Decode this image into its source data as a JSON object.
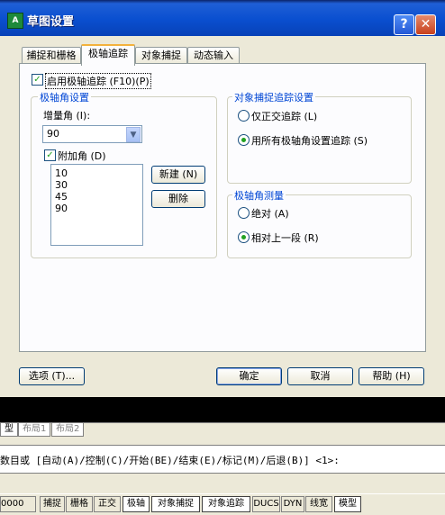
{
  "window": {
    "title": "草图设置",
    "app_icon": "autocad-app-icon",
    "help_glyph": "?",
    "close_glyph": "✕"
  },
  "tabs": [
    {
      "label": "捕捉和栅格",
      "active": false
    },
    {
      "label": "极轴追踪",
      "active": true
    },
    {
      "label": "对象捕捉",
      "active": false
    },
    {
      "label": "动态输入",
      "active": false
    }
  ],
  "polar": {
    "enable_label": "启用极轴追踪 (F10)(P)",
    "enable_checked": true,
    "group_title": "极轴角设置",
    "increment_label": "增量角 (I):",
    "increment_value": "90",
    "additional_label": "附加角 (D)",
    "additional_checked": true,
    "additional_angles": [
      "10",
      "30",
      "45",
      "90"
    ],
    "new_button": "新建 (N)",
    "delete_button": "删除"
  },
  "snap_tracking": {
    "group_title": "对象捕捉追踪设置",
    "orthogonal_label": "仅正交追踪 (L)",
    "orthogonal_selected": false,
    "all_polar_label": "用所有极轴角设置追踪 (S)",
    "all_polar_selected": true
  },
  "polar_measure": {
    "group_title": "极轴角测量",
    "absolute_label": "绝对 (A)",
    "absolute_selected": false,
    "relative_label": "相对上一段 (R)",
    "relative_selected": true
  },
  "footer": {
    "options_button": "选项 (T)...",
    "ok_button": "确定",
    "cancel_button": "取消",
    "help_button": "帮助 (H)"
  },
  "layout_tabs": [
    "型",
    "布局1",
    "布局2"
  ],
  "command_line": "数目或 [自动(A)/控制(C)/开始(BE)/结束(E)/标记(M)/后退(B)] <1>:",
  "status_bar": {
    "coordinates": "0000",
    "buttons": [
      {
        "label": "捕捉",
        "on": false
      },
      {
        "label": "栅格",
        "on": false
      },
      {
        "label": "正交",
        "on": false
      },
      {
        "label": "极轴",
        "on": true
      },
      {
        "label": "对象捕捉",
        "on": true
      },
      {
        "label": "对象追踪",
        "on": true
      },
      {
        "label": "DUCS",
        "on": false
      },
      {
        "label": "DYN",
        "on": false
      },
      {
        "label": "线宽",
        "on": false
      },
      {
        "label": "模型",
        "on": true
      }
    ]
  },
  "colors": {
    "title_bar": "#0a4fd0",
    "group_title": "#0046d5",
    "check_mark": "#21a121",
    "tab_highlight": "#f3b23c"
  }
}
